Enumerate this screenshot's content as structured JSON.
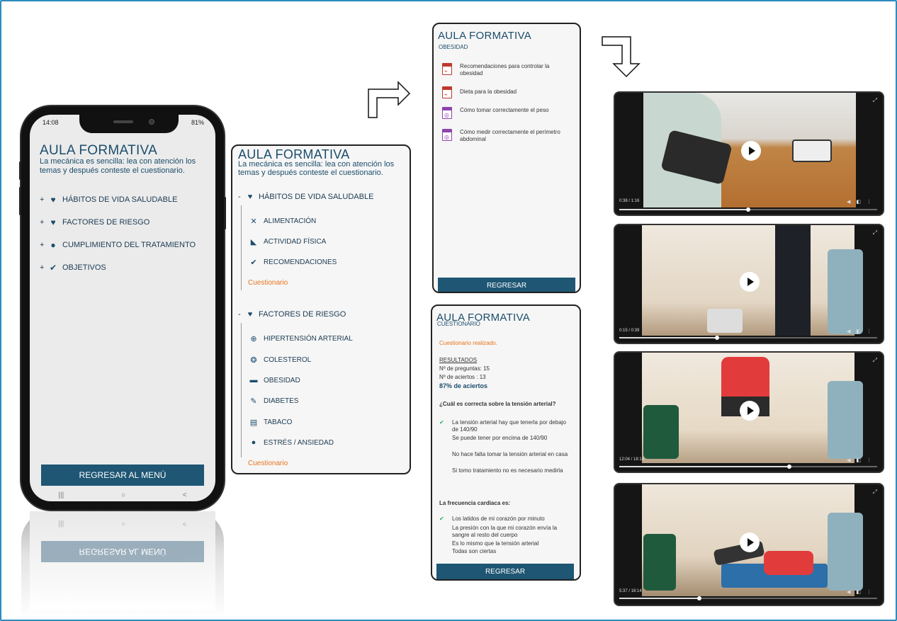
{
  "phone": {
    "status_time": "14:08",
    "status_battery": "81%",
    "title": "AULA FORMATIVA",
    "description": "La mecánica es sencilla: lea con atención los temas y después conteste el cuestionario.",
    "menu": [
      {
        "plus": "+",
        "icon": "heart-icon",
        "label": "HÁBITOS DE VIDA SALUDABLE"
      },
      {
        "plus": "+",
        "icon": "broken-heart-icon",
        "label": "FACTORES DE RIESGO"
      },
      {
        "plus": "+",
        "icon": "pills-icon",
        "label": "CUMPLIMIENTO DEL TRATAMIENTO"
      },
      {
        "plus": "+",
        "icon": "check-circle-icon",
        "label": "OBJETIVOS"
      }
    ],
    "button": "REGRESAR AL MENÚ",
    "nav": [
      "|||",
      "○",
      "<"
    ]
  },
  "expanded": {
    "title": "AULA FORMATIVA",
    "description": "La mecánica es sencilla: lea con atención los temas y después conteste el cuestionario.",
    "section1": {
      "toggle": "-",
      "label": "HÁBITOS DE VIDA SALUDABLE",
      "items": [
        "ALIMENTACIÓN",
        "ACTIVIDAD FÍSICA",
        "RECOMENDACIONES"
      ],
      "quiz": "Cuestionario"
    },
    "section2": {
      "toggle": "-",
      "label": "FACTORES DE RIESGO",
      "items": [
        "HIPERTENSIÓN ARTERIAL",
        "COLESTEROL",
        "OBESIDAD",
        "DIABETES",
        "TABACO",
        "ESTRÉS / ANSIEDAD"
      ],
      "quiz": "Cuestionario"
    }
  },
  "obesidad": {
    "title": "AULA FORMATIVA",
    "subtitle": "OBESIDAD",
    "docs": [
      {
        "type": "pdf",
        "label": "Recomendaciones para controlar la obesidad"
      },
      {
        "type": "pdf",
        "label": "Dieta para la obesidad"
      },
      {
        "type": "video",
        "label": "Cómo tomar correctamente el peso"
      },
      {
        "type": "video",
        "label": "Cómo medir correctamente el perímetro abdominal"
      }
    ],
    "button": "REGRESAR"
  },
  "cuestionario": {
    "title": "AULA FORMATIVA",
    "subtitle": "CUESTIONARIO",
    "done": "Cuestionario realizado.",
    "results_label": "RESULTADOS",
    "questions_count": "Nº de preguntas: 15",
    "correct_count": "Nº de aciertos : 13",
    "score": "87% de aciertos",
    "q1": "¿Cuál es correcta sobre la tensión arterial?",
    "q1_answers": [
      "La tensión arterial hay que tenerla por debajo de 140/90",
      "Se puede tener por encima de 140/90",
      "No hace falta tomar la tensión arterial en casa",
      "Si tomo tratamiento no es necesario medirla"
    ],
    "q2": "La frecuencia cardiaca es:",
    "q2_answers": [
      "Los latidos de mi corazón por minuto",
      "La presión con la que mi corazón envía la sangre al resto del cuerpo",
      "Es lo mismo que la tensión arterial",
      "Todas son ciertas"
    ],
    "button": "REGRESAR"
  },
  "videos": [
    {
      "time": "0:38 / 1:16",
      "progress": 0.5
    },
    {
      "time": "0:15 / 0:39",
      "progress": 0.38
    },
    {
      "time": "12:04 / 18:14",
      "progress": 0.66
    },
    {
      "time": "5:37 / 18:14",
      "progress": 0.31
    }
  ],
  "colors": {
    "primary": "#1e5673",
    "title": "#1b4d6b",
    "accent": "#e8741c",
    "check": "#27ae60",
    "frame": "#2b8cbf"
  }
}
